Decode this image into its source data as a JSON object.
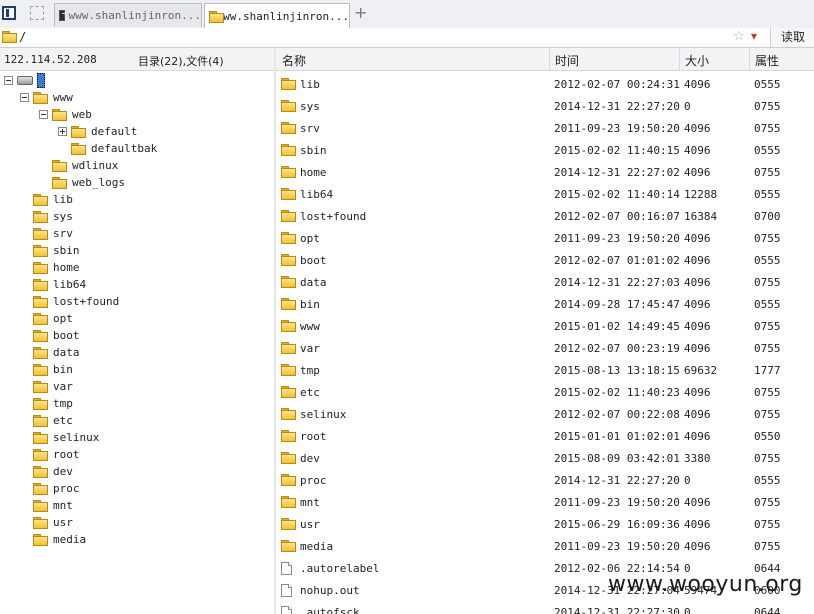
{
  "tabs": [
    {
      "title": "www.shanlinjinron...",
      "icon": "terminal-icon",
      "active": false
    },
    {
      "title": "www.shanlinjinron...",
      "icon": "folder-icon",
      "active": true
    }
  ],
  "address": {
    "path": "/",
    "read_button": "读取",
    "star": "☆",
    "dropdown": "▾"
  },
  "info": {
    "host": "122.114.52.208",
    "summary": "目录(22),文件(4)"
  },
  "columns": {
    "name": "名称",
    "time": "时间",
    "size": "大小",
    "attr": "属性"
  },
  "tree": [
    {
      "label": "",
      "type": "root",
      "depth": 0,
      "toggle": "minus"
    },
    {
      "label": "www",
      "type": "folder",
      "depth": 1,
      "toggle": "minus"
    },
    {
      "label": "web",
      "type": "folder",
      "depth": 2,
      "toggle": "minus"
    },
    {
      "label": "default",
      "type": "folder",
      "depth": 3,
      "toggle": "plus"
    },
    {
      "label": "defaultbak",
      "type": "folder",
      "depth": 3,
      "toggle": ""
    },
    {
      "label": "wdlinux",
      "type": "folder",
      "depth": 2,
      "toggle": ""
    },
    {
      "label": "web_logs",
      "type": "folder",
      "depth": 2,
      "toggle": ""
    },
    {
      "label": "lib",
      "type": "folder",
      "depth": 1,
      "toggle": ""
    },
    {
      "label": "sys",
      "type": "folder",
      "depth": 1,
      "toggle": ""
    },
    {
      "label": "srv",
      "type": "folder",
      "depth": 1,
      "toggle": ""
    },
    {
      "label": "sbin",
      "type": "folder",
      "depth": 1,
      "toggle": ""
    },
    {
      "label": "home",
      "type": "folder",
      "depth": 1,
      "toggle": ""
    },
    {
      "label": "lib64",
      "type": "folder",
      "depth": 1,
      "toggle": ""
    },
    {
      "label": "lost+found",
      "type": "folder",
      "depth": 1,
      "toggle": ""
    },
    {
      "label": "opt",
      "type": "folder",
      "depth": 1,
      "toggle": ""
    },
    {
      "label": "boot",
      "type": "folder",
      "depth": 1,
      "toggle": ""
    },
    {
      "label": "data",
      "type": "folder",
      "depth": 1,
      "toggle": ""
    },
    {
      "label": "bin",
      "type": "folder",
      "depth": 1,
      "toggle": ""
    },
    {
      "label": "var",
      "type": "folder",
      "depth": 1,
      "toggle": ""
    },
    {
      "label": "tmp",
      "type": "folder",
      "depth": 1,
      "toggle": ""
    },
    {
      "label": "etc",
      "type": "folder",
      "depth": 1,
      "toggle": ""
    },
    {
      "label": "selinux",
      "type": "folder",
      "depth": 1,
      "toggle": ""
    },
    {
      "label": "root",
      "type": "folder",
      "depth": 1,
      "toggle": ""
    },
    {
      "label": "dev",
      "type": "folder",
      "depth": 1,
      "toggle": ""
    },
    {
      "label": "proc",
      "type": "folder",
      "depth": 1,
      "toggle": ""
    },
    {
      "label": "mnt",
      "type": "folder",
      "depth": 1,
      "toggle": ""
    },
    {
      "label": "usr",
      "type": "folder",
      "depth": 1,
      "toggle": ""
    },
    {
      "label": "media",
      "type": "folder",
      "depth": 1,
      "toggle": ""
    }
  ],
  "files": [
    {
      "name": "lib",
      "time": "2012-02-07 00:24:31",
      "size": "4096",
      "attr": "0555",
      "type": "folder"
    },
    {
      "name": "sys",
      "time": "2014-12-31 22:27:20",
      "size": "0",
      "attr": "0755",
      "type": "folder"
    },
    {
      "name": "srv",
      "time": "2011-09-23 19:50:20",
      "size": "4096",
      "attr": "0755",
      "type": "folder"
    },
    {
      "name": "sbin",
      "time": "2015-02-02 11:40:15",
      "size": "4096",
      "attr": "0555",
      "type": "folder"
    },
    {
      "name": "home",
      "time": "2014-12-31 22:27:02",
      "size": "4096",
      "attr": "0755",
      "type": "folder"
    },
    {
      "name": "lib64",
      "time": "2015-02-02 11:40:14",
      "size": "12288",
      "attr": "0555",
      "type": "folder"
    },
    {
      "name": "lost+found",
      "time": "2012-02-07 00:16:07",
      "size": "16384",
      "attr": "0700",
      "type": "folder"
    },
    {
      "name": "opt",
      "time": "2011-09-23 19:50:20",
      "size": "4096",
      "attr": "0755",
      "type": "folder"
    },
    {
      "name": "boot",
      "time": "2012-02-07 01:01:02",
      "size": "4096",
      "attr": "0555",
      "type": "folder"
    },
    {
      "name": "data",
      "time": "2014-12-31 22:27:03",
      "size": "4096",
      "attr": "0755",
      "type": "folder"
    },
    {
      "name": "bin",
      "time": "2014-09-28 17:45:47",
      "size": "4096",
      "attr": "0555",
      "type": "folder"
    },
    {
      "name": "www",
      "time": "2015-01-02 14:49:45",
      "size": "4096",
      "attr": "0755",
      "type": "folder"
    },
    {
      "name": "var",
      "time": "2012-02-07 00:23:19",
      "size": "4096",
      "attr": "0755",
      "type": "folder"
    },
    {
      "name": "tmp",
      "time": "2015-08-13 13:18:15",
      "size": "69632",
      "attr": "1777",
      "type": "folder"
    },
    {
      "name": "etc",
      "time": "2015-02-02 11:40:23",
      "size": "4096",
      "attr": "0755",
      "type": "folder"
    },
    {
      "name": "selinux",
      "time": "2012-02-07 00:22:08",
      "size": "4096",
      "attr": "0755",
      "type": "folder"
    },
    {
      "name": "root",
      "time": "2015-01-01 01:02:01",
      "size": "4096",
      "attr": "0550",
      "type": "folder"
    },
    {
      "name": "dev",
      "time": "2015-08-09 03:42:01",
      "size": "3380",
      "attr": "0755",
      "type": "folder"
    },
    {
      "name": "proc",
      "time": "2014-12-31 22:27:20",
      "size": "0",
      "attr": "0555",
      "type": "folder"
    },
    {
      "name": "mnt",
      "time": "2011-09-23 19:50:20",
      "size": "4096",
      "attr": "0755",
      "type": "folder"
    },
    {
      "name": "usr",
      "time": "2015-06-29 16:09:36",
      "size": "4096",
      "attr": "0755",
      "type": "folder"
    },
    {
      "name": "media",
      "time": "2011-09-23 19:50:20",
      "size": "4096",
      "attr": "0755",
      "type": "folder"
    },
    {
      "name": ".autorelabel",
      "time": "2012-02-06 22:14:54",
      "size": "0",
      "attr": "0644",
      "type": "file"
    },
    {
      "name": "nohup.out",
      "time": "2014-12-31 22:27:04",
      "size": "59474",
      "attr": "0600",
      "type": "file"
    },
    {
      "name": ".autofsck",
      "time": "2014-12-31 22:27:30",
      "size": "0",
      "attr": "0644",
      "type": "file"
    }
  ],
  "watermark": "www.wooyun.org"
}
